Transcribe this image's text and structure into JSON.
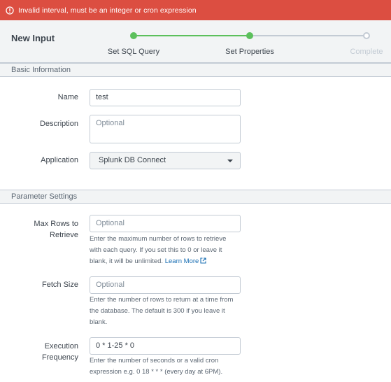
{
  "error": {
    "message": "Invalid interval, must be an integer or cron expression",
    "icon": "warning-icon",
    "color": "#dc4e41"
  },
  "wizard": {
    "title": "New Input",
    "steps": [
      {
        "label": "Set SQL Query",
        "status": "done"
      },
      {
        "label": "Set Properties",
        "status": "done"
      },
      {
        "label": "Complete",
        "status": "pending"
      }
    ],
    "accent_color": "#5cc05c"
  },
  "basic": {
    "header": "Basic Information",
    "name": {
      "label": "Name",
      "value": "test"
    },
    "description": {
      "label": "Description",
      "placeholder": "Optional",
      "value": ""
    },
    "application": {
      "label": "Application",
      "value": "Splunk DB Connect"
    }
  },
  "params": {
    "header": "Parameter Settings",
    "max_rows": {
      "label_line1": "Max Rows to",
      "label_line2": "Retrieve",
      "placeholder": "Optional",
      "help_line1": "Enter the maximum number of rows to retrieve",
      "help_line2": "with each query. If you set this to 0 or leave it",
      "help_line3_prefix": "blank, it will be unlimited.",
      "learn_more": "Learn More"
    },
    "fetch_size": {
      "label": "Fetch Size",
      "placeholder": "Optional",
      "help_line1": "Enter the number of rows to return at a time from",
      "help_line2": "the database. The default is 300 if you leave it",
      "help_line3": "blank."
    },
    "execution_frequency": {
      "label_line1": "Execution",
      "label_line2": "Frequency",
      "value": "0 * 1-25 * 0",
      "help_line1": "Enter the number of seconds or a valid cron",
      "help_line2": "expression e.g. 0 18 * * * (every day at 6PM)."
    }
  }
}
